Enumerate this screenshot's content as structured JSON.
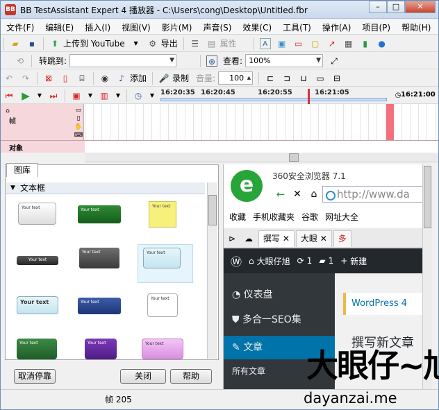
{
  "window": {
    "title": "BB TestAssistant Expert 4 播放器 - C:\\Users\\cong\\Desktop\\Untitled.fbr",
    "icon": "app-logo-icon"
  },
  "menu": [
    "文件(F)",
    "编辑(E)",
    "插入(I)",
    "视图(V)",
    "影片(M)",
    "声音(S)",
    "效果(C)",
    "工具(T)",
    "操作(A)",
    "项目(P)",
    "帮助(H)"
  ],
  "toolbar1": {
    "upload_label": "上传到 YouTube",
    "export_label": "导出",
    "properties_label": "属性"
  },
  "toolbar2": {
    "goto_label": "转跳到:",
    "goto_value": "",
    "view_label": "查看:",
    "zoom_value": "100%"
  },
  "toolbar3": {
    "add_label": "添加",
    "record_label": "录制",
    "volume_label": "音量:",
    "volume_value": "100"
  },
  "timeline": {
    "ticks": [
      "16:20:35",
      "16:20:45",
      "16:20:55",
      "16:21:05"
    ],
    "current_time": "16:21:00",
    "row_frames": "帧",
    "row_objects": "对象"
  },
  "library": {
    "tab_label": "图库",
    "section_label": "文本框",
    "sample_text": "Your text",
    "sample_text_bold": "Your text"
  },
  "buttons": {
    "undock": "取消停靠",
    "close": "关闭",
    "help": "帮助"
  },
  "status": {
    "frame": "帧 205"
  },
  "preview": {
    "browser_title": "360安全浏览器 7.1",
    "url": "http://www.da",
    "bookmarks": [
      "收藏",
      "手机收藏夹",
      "谷歌",
      "网址大全"
    ],
    "tabs": [
      "撰写",
      "大眼",
      "多"
    ],
    "wp_site": "大眼仔旭",
    "wp_updates": "1",
    "wp_comments": "1",
    "wp_new": "新建",
    "sidebar": [
      "仪表盘",
      "多合一SEO集",
      "文章",
      "所有文章"
    ],
    "notice": "WordPress 4",
    "heading": "撰写新文章"
  },
  "watermark": {
    "cn": "大眼仔~旭",
    "url": "dayanzai.me"
  }
}
